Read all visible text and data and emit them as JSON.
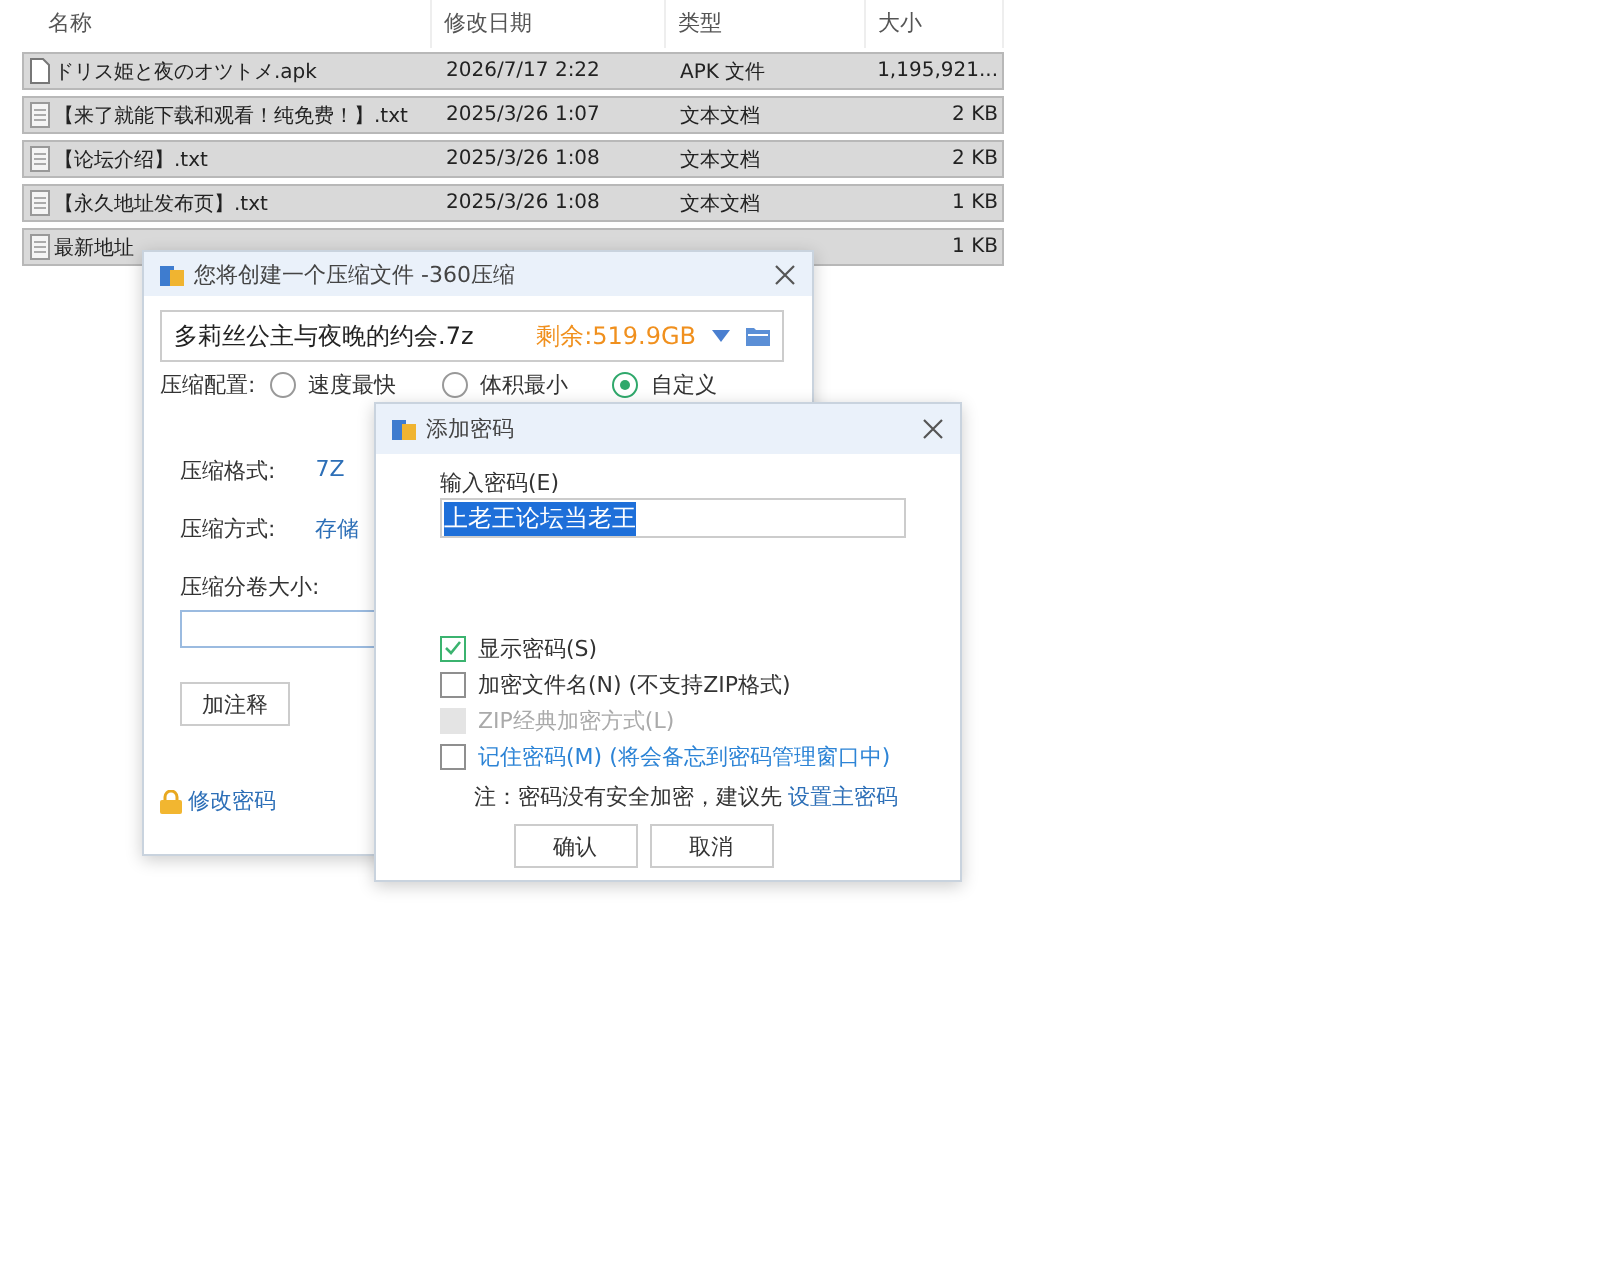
{
  "file_list": {
    "columns": [
      {
        "label": "名称"
      },
      {
        "label": "修改日期"
      },
      {
        "label": "类型"
      },
      {
        "label": "大小"
      }
    ],
    "rows": [
      {
        "kind": "blank",
        "name": "ドリス姫と夜のオツトメ.apk",
        "date": "2026/7/17 2:22",
        "type": "APK 文件",
        "size": "1,195,921..."
      },
      {
        "kind": "text",
        "name": "【来了就能下载和观看！纯免费！】.txt",
        "date": "2025/3/26 1:07",
        "type": "文本文档",
        "size": "2 KB"
      },
      {
        "kind": "text",
        "name": "【论坛介绍】.txt",
        "date": "2025/3/26 1:08",
        "type": "文本文档",
        "size": "2 KB"
      },
      {
        "kind": "text",
        "name": "【永久地址发布页】.txt",
        "date": "2025/3/26 1:08",
        "type": "文本文档",
        "size": "1 KB"
      },
      {
        "kind": "text",
        "name": "最新地址",
        "size": "1 KB"
      }
    ]
  },
  "compress_dialog": {
    "title": "您将创建一个压缩文件 -360压缩",
    "filename": "多莉丝公主与夜晚的约会.7z",
    "free_space": "剩余:519.9GB",
    "config_label": "压缩配置:",
    "presets": [
      {
        "label": "速度最快",
        "selected": false
      },
      {
        "label": "体积最小",
        "selected": false
      },
      {
        "label": "自定义",
        "selected": true
      }
    ],
    "format_label": "压缩格式:",
    "format_value": "7Z",
    "method_label": "压缩方式:",
    "method_value": "存储",
    "volume_label": "压缩分卷大小:",
    "comment_button": "加注释",
    "change_password_link": "修改密码"
  },
  "password_dialog": {
    "title": "添加密码",
    "input_label": "输入密码(E)",
    "password": "上老王论坛当老王",
    "password_selected": true,
    "options": [
      {
        "label": "显示密码(S)",
        "checked": true,
        "disabled": false,
        "kind": "plain"
      },
      {
        "label": "加密文件名(N) (不支持ZIP格式)",
        "checked": false,
        "disabled": false,
        "kind": "plain"
      },
      {
        "label": "ZIP经典加密方式(L)",
        "checked": false,
        "disabled": true,
        "kind": "plain"
      },
      {
        "label": "记住密码(M) (将会备忘到密码管理窗口中)",
        "checked": false,
        "disabled": false,
        "kind": "link"
      }
    ],
    "note": "注：密码没有安全加密，建议先",
    "note_link": "设置主密码",
    "buttons": [
      {
        "label": "确认"
      },
      {
        "label": "取消"
      }
    ]
  }
}
